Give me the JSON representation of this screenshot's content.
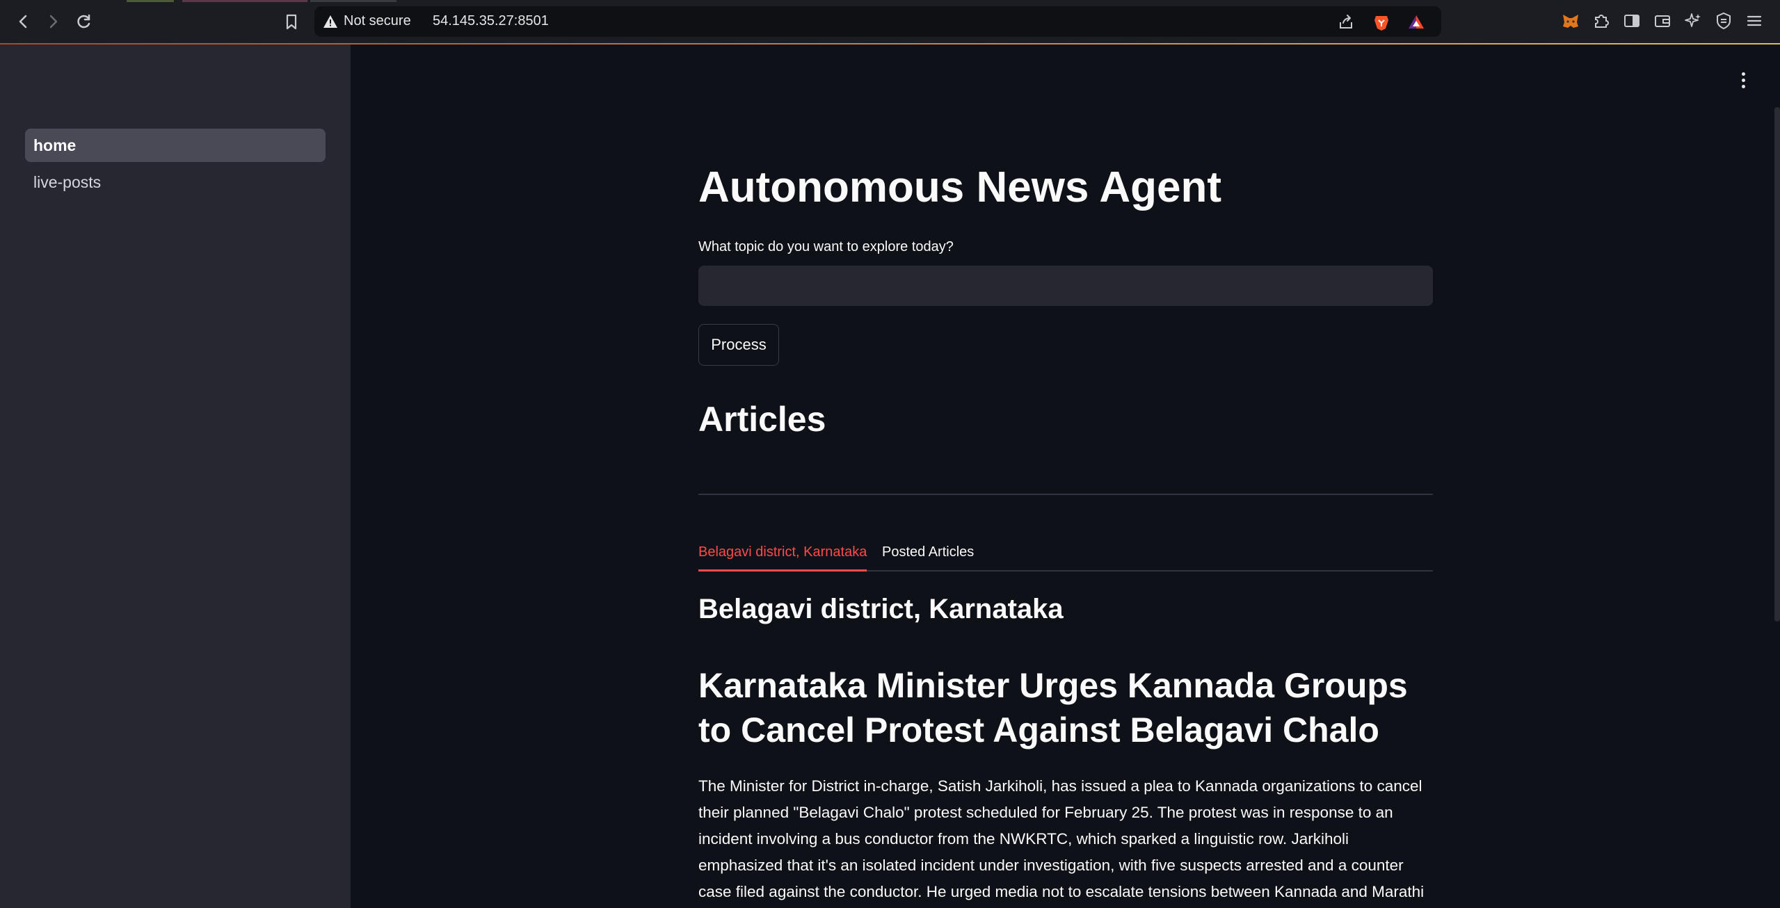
{
  "browser": {
    "security_label": "Not secure",
    "url": "54.145.35.27:8501",
    "icons": {
      "back": "back-arrow-icon",
      "forward": "forward-arrow-icon",
      "reload": "reload-icon",
      "bookmark": "bookmark-icon",
      "share": "share-icon",
      "brave_shields": "brave-lion-icon",
      "brave_rewards": "brave-rewards-triangle-icon",
      "extensions": [
        "metamask-fox-icon",
        "puzzle-extensions-icon",
        "sidebar-toggle-icon",
        "wallet-icon",
        "leo-ai-icon",
        "vpn-shield-icon",
        "menu-hamburger-icon"
      ]
    }
  },
  "sidebar": {
    "items": [
      {
        "label": "home",
        "active": true
      },
      {
        "label": "live-posts",
        "active": false
      }
    ]
  },
  "main": {
    "title": "Autonomous News Agent",
    "topic_label": "What topic do you want to explore today?",
    "topic_value": "",
    "process_label": "Process",
    "articles_heading": "Articles",
    "tabs": [
      {
        "label": "Belagavi district, Karnataka",
        "active": true
      },
      {
        "label": "Posted Articles",
        "active": false
      }
    ],
    "subheader": "Belagavi district, Karnataka",
    "article": {
      "title": "Karnataka Minister Urges Kannada Groups to Cancel Protest Against Belagavi Chalo",
      "body": "The Minister for District in-charge, Satish Jarkiholi, has issued a plea to Kannada organizations to cancel their planned \"Belagavi Chalo\" protest scheduled for February 25. The protest was in response to an incident involving a bus conductor from the NWKRTC, which sparked a linguistic row. Jarkiholi emphasized that it's an isolated incident under investigation, with five suspects arrested and a counter case filed against the conductor. He urged media not to escalate tensions between Kannada and Marathi"
    }
  },
  "colors": {
    "accent": "#ff4b4b",
    "background": "#0e1117",
    "sidebar": "#262730"
  }
}
